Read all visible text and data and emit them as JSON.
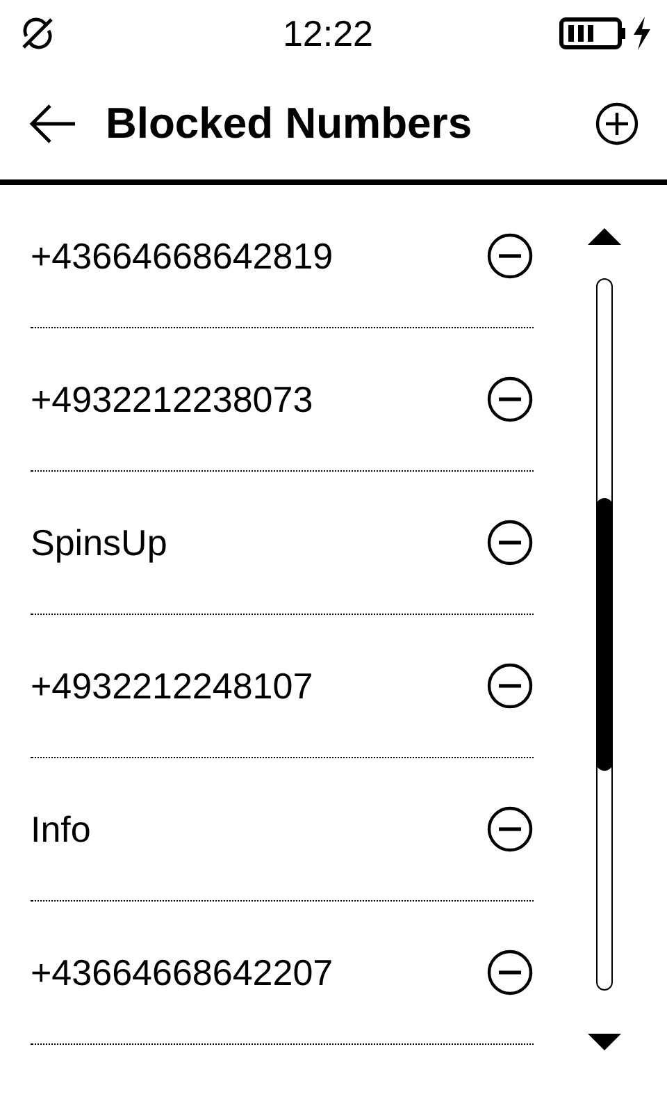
{
  "status_bar": {
    "time": "12:22"
  },
  "header": {
    "title": "Blocked Numbers"
  },
  "blocked": [
    {
      "name": "+43664668642819"
    },
    {
      "name": "+4932212238073"
    },
    {
      "name": "SpinsUp"
    },
    {
      "name": "+4932212248107"
    },
    {
      "name": "Info"
    },
    {
      "name": "+43664668642207"
    }
  ]
}
